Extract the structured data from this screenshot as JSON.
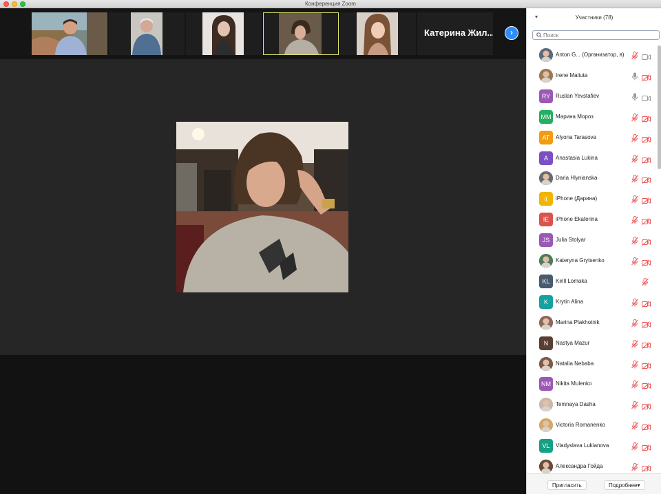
{
  "window": {
    "title": "Конференция Zoom"
  },
  "strip": {
    "name_tile": "Катерина Жил..."
  },
  "panel": {
    "title": "Участники (78)",
    "search_placeholder": "Поиск",
    "invite_label": "Пригласить",
    "more_label": "Подробнее"
  },
  "participants": [
    {
      "name": "Anton G...  (Организатор, я)",
      "initials": "",
      "avatar": "photo",
      "color": "#5b6b7a",
      "mic": "muted",
      "cam": "on"
    },
    {
      "name": "Irene Maliuta",
      "initials": "",
      "avatar": "photo",
      "color": "#9b7a55",
      "mic": "on",
      "cam": "off"
    },
    {
      "name": "Ruslan Yevstafiev",
      "initials": "RY",
      "avatar": "initials",
      "color": "#9b59b6",
      "mic": "on",
      "cam": "on"
    },
    {
      "name": "Марина Мороз",
      "initials": "ММ",
      "avatar": "initials",
      "color": "#27ae60",
      "mic": "muted",
      "cam": "off"
    },
    {
      "name": "Alyona Tarasova",
      "initials": "AT",
      "avatar": "initials",
      "color": "#f39c12",
      "mic": "muted",
      "cam": "off"
    },
    {
      "name": "Anastasia Lukina",
      "initials": "A",
      "avatar": "initials",
      "color": "#7d4fc4",
      "mic": "muted",
      "cam": "off"
    },
    {
      "name": "Daria Hlynianska",
      "initials": "",
      "avatar": "photo",
      "color": "#6a6a6a",
      "mic": "muted",
      "cam": "off"
    },
    {
      "name": "iPhone (Дарина)",
      "initials": "i(",
      "avatar": "initials",
      "color": "#f1b400",
      "mic": "muted",
      "cam": "off"
    },
    {
      "name": "iPhone Ekaterina",
      "initials": "IE",
      "avatar": "initials",
      "color": "#d9534f",
      "mic": "muted",
      "cam": "off"
    },
    {
      "name": "Julia Stolyar",
      "initials": "JS",
      "avatar": "initials",
      "color": "#9b59b6",
      "mic": "muted",
      "cam": "off"
    },
    {
      "name": "Kateryna Grytsenko",
      "initials": "",
      "avatar": "photo",
      "color": "#4f7d5a",
      "mic": "muted",
      "cam": "off"
    },
    {
      "name": "Kirill Lomaka",
      "initials": "KL",
      "avatar": "initials",
      "color": "#4a5a6e",
      "mic": "muted",
      "cam": "none"
    },
    {
      "name": "Krytin Alina",
      "initials": "K",
      "avatar": "initials",
      "color": "#16a0a0",
      "mic": "muted",
      "cam": "off"
    },
    {
      "name": "Marina Plakhotnik",
      "initials": "",
      "avatar": "photo",
      "color": "#8a6a5a",
      "mic": "muted",
      "cam": "off"
    },
    {
      "name": "Nastya Mazur",
      "initials": "N",
      "avatar": "initials",
      "color": "#5a3e32",
      "mic": "muted",
      "cam": "off"
    },
    {
      "name": "Natalia Nebaba",
      "initials": "",
      "avatar": "photo",
      "color": "#7a5a48",
      "mic": "muted",
      "cam": "off"
    },
    {
      "name": "Nikita Mulenko",
      "initials": "NM",
      "avatar": "initials",
      "color": "#9b59b6",
      "mic": "muted",
      "cam": "off"
    },
    {
      "name": "Temnaya Dasha",
      "initials": "",
      "avatar": "photo",
      "color": "#c9b8ad",
      "mic": "muted",
      "cam": "off"
    },
    {
      "name": "Victoria Romanenko",
      "initials": "",
      "avatar": "photo",
      "color": "#d4a86a",
      "mic": "muted",
      "cam": "off"
    },
    {
      "name": "Vladyslava Lukianova",
      "initials": "VL",
      "avatar": "initials",
      "color": "#16a085",
      "mic": "muted",
      "cam": "off"
    },
    {
      "name": "Александра Гойда",
      "initials": "",
      "avatar": "photo",
      "color": "#6b4a3a",
      "mic": "muted",
      "cam": "off"
    }
  ]
}
